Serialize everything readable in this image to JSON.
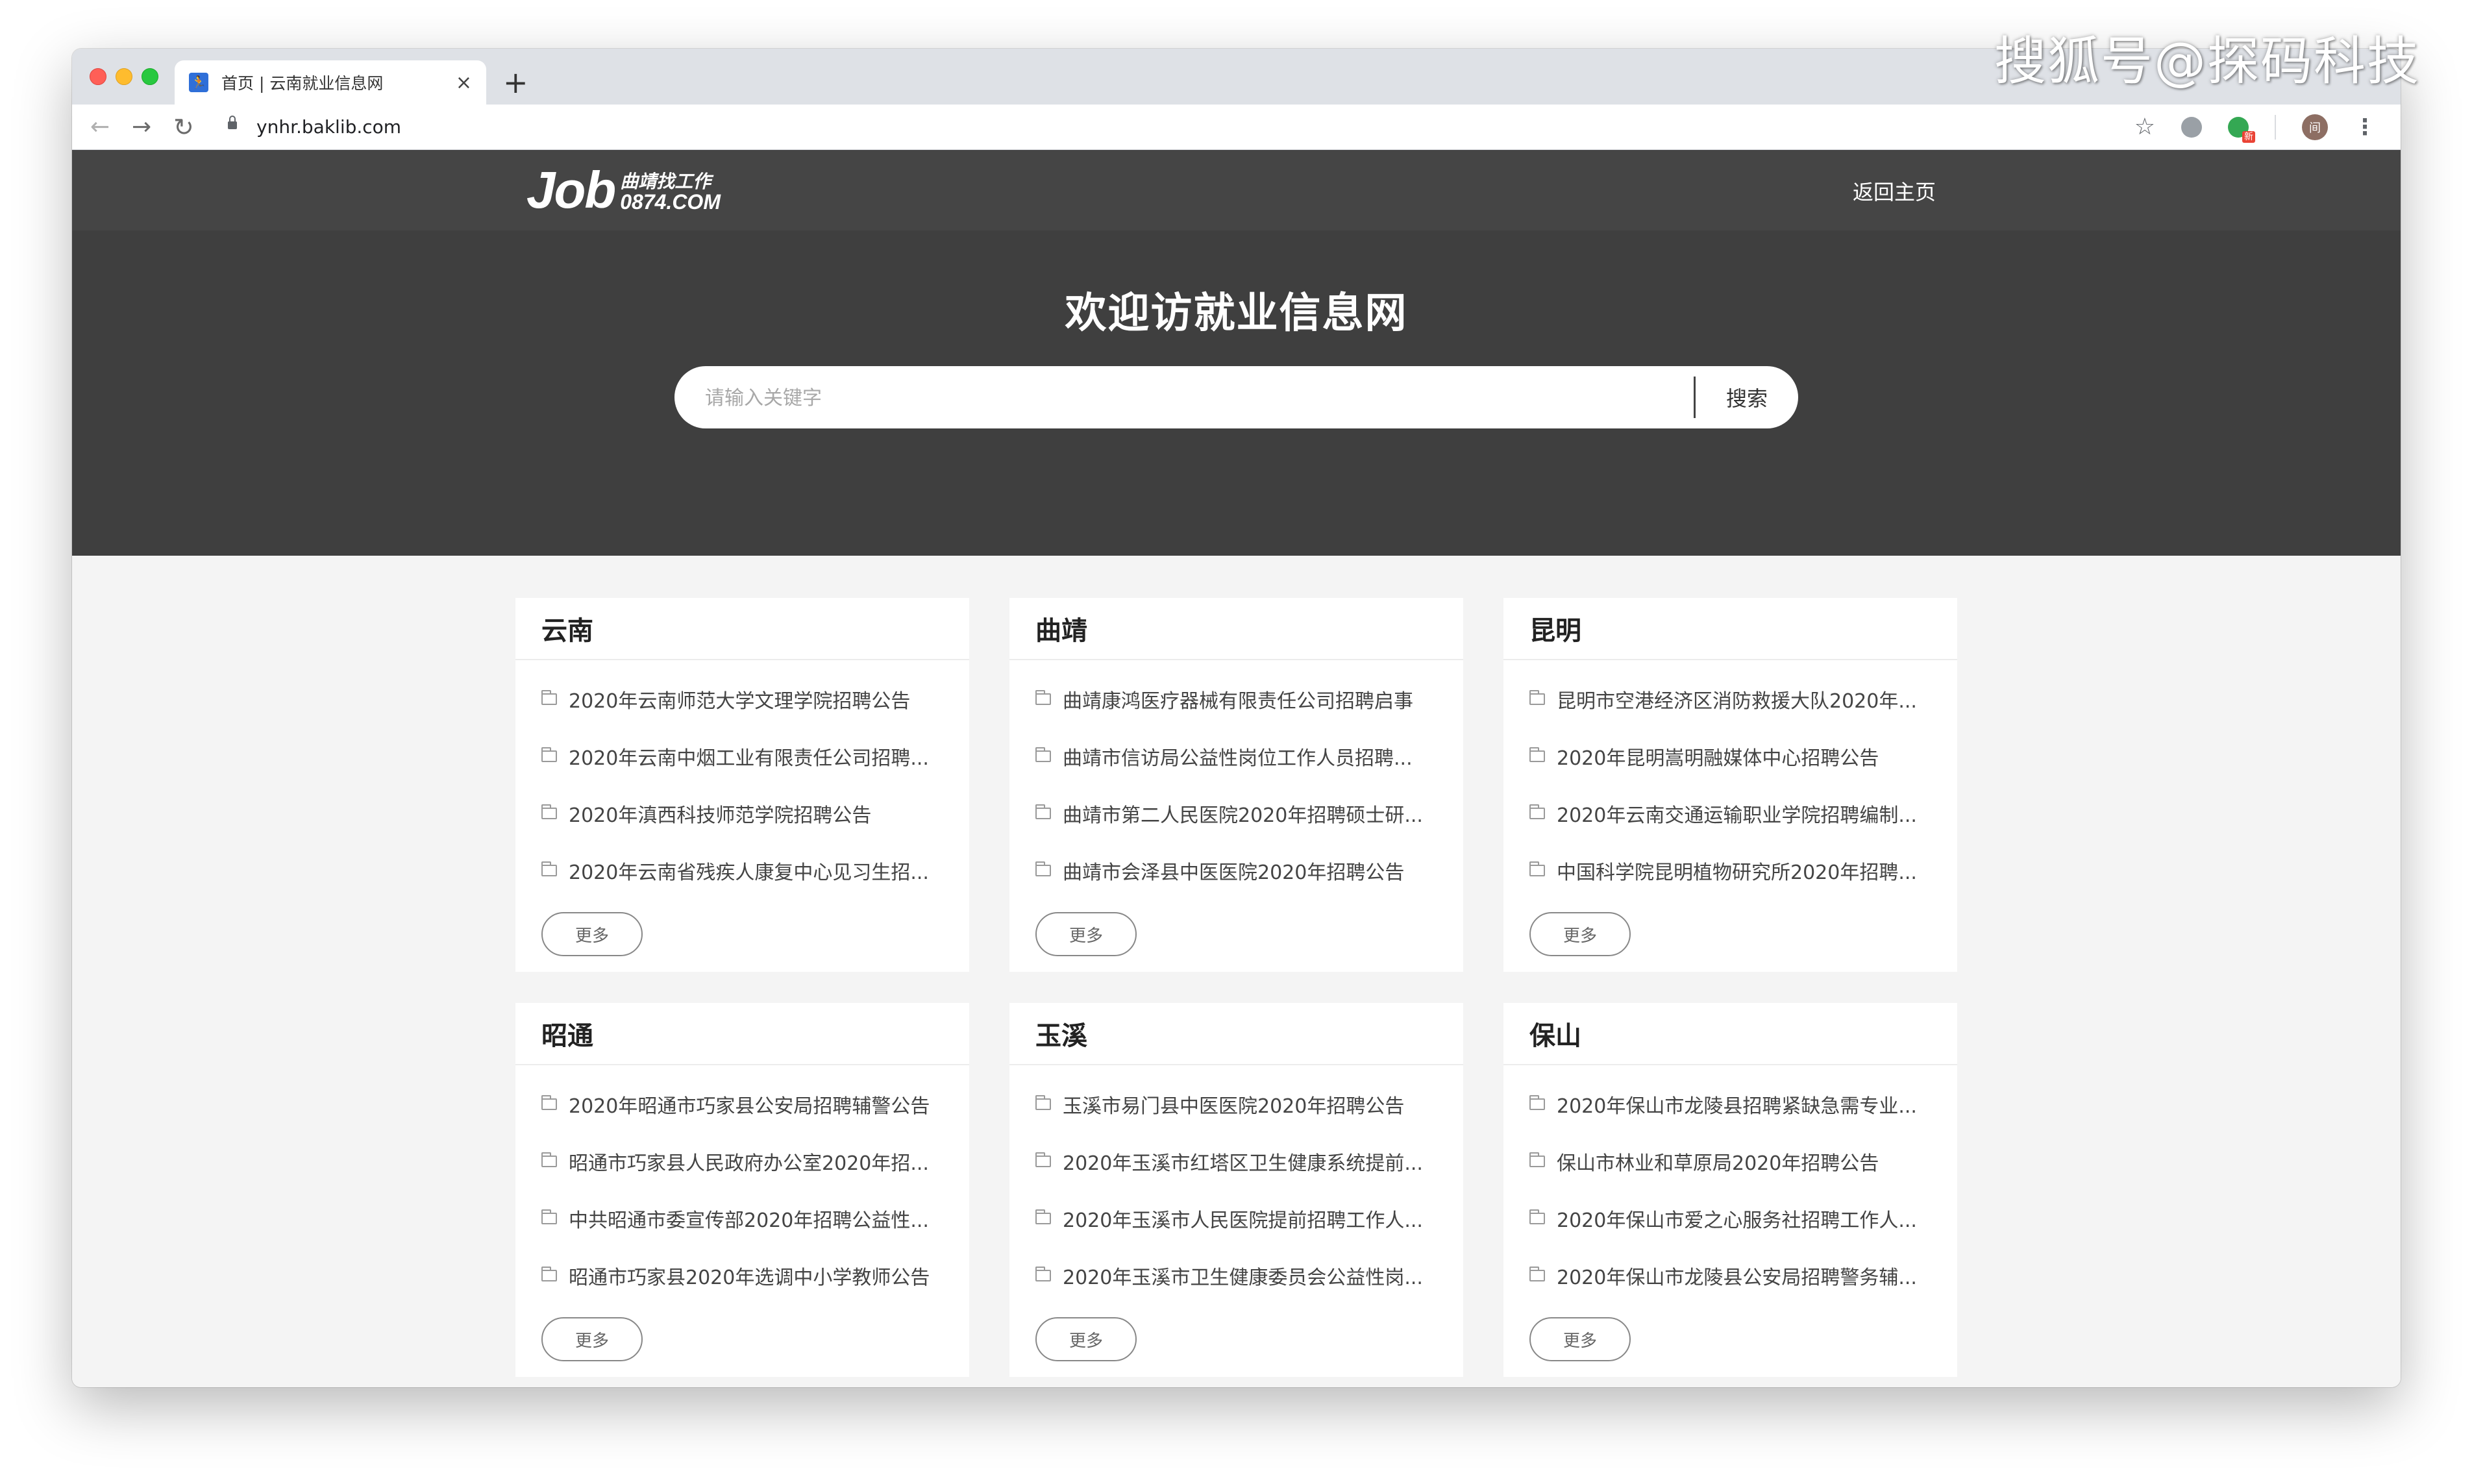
{
  "watermark": "搜狐号@探码科技",
  "browser": {
    "tab_title": "首页 | 云南就业信息网",
    "tab_favicon": "🏃",
    "tab_close": "×",
    "new_tab": "+",
    "url": "ynhr.baklib.com",
    "ext_badge": "新",
    "avatar_label": "间",
    "icons": {
      "back": "back-arrow-icon",
      "forward": "forward-arrow-icon",
      "reload": "reload-icon",
      "lock": "lock-icon",
      "bookmark": "star-icon",
      "menu": "kebab-icon"
    }
  },
  "header": {
    "logo_main": "Job",
    "logo_cn": "曲靖找工作",
    "logo_en": "0874.COM",
    "home_link": "返回主页"
  },
  "hero": {
    "title": "欢迎访就业信息网",
    "search_placeholder": "请输入关键字",
    "search_button": "搜索"
  },
  "colors": {
    "hero_bg": "#3f3f3f",
    "topbar_bg": "#454545",
    "page_bg": "#f4f4f4",
    "card_bg": "#ffffff"
  },
  "sections": [
    {
      "title": "云南",
      "items": [
        "2020年云南师范大学文理学院招聘公告",
        "2020年云南中烟工业有限责任公司招聘...",
        "2020年滇西科技师范学院招聘公告",
        "2020年云南省残疾人康复中心见习生招..."
      ],
      "more": "更多"
    },
    {
      "title": "曲靖",
      "items": [
        "曲靖康鸿医疗器械有限责任公司招聘启事",
        "曲靖市信访局公益性岗位工作人员招聘...",
        "曲靖市第二人民医院2020年招聘硕士研...",
        "曲靖市会泽县中医医院2020年招聘公告"
      ],
      "more": "更多"
    },
    {
      "title": "昆明",
      "items": [
        "昆明市空港经济区消防救援大队2020年...",
        "2020年昆明嵩明融媒体中心招聘公告",
        "2020年云南交通运输职业学院招聘编制...",
        "中国科学院昆明植物研究所2020年招聘..."
      ],
      "more": "更多"
    },
    {
      "title": "昭通",
      "items": [
        "2020年昭通市巧家县公安局招聘辅警公告",
        "昭通市巧家县人民政府办公室2020年招...",
        "中共昭通市委宣传部2020年招聘公益性...",
        "昭通市巧家县2020年选调中小学教师公告"
      ],
      "more": "更多"
    },
    {
      "title": "玉溪",
      "items": [
        "玉溪市易门县中医医院2020年招聘公告",
        "2020年玉溪市红塔区卫生健康系统提前...",
        "2020年玉溪市人民医院提前招聘工作人...",
        "2020年玉溪市卫生健康委员会公益性岗..."
      ],
      "more": "更多"
    },
    {
      "title": "保山",
      "items": [
        "2020年保山市龙陵县招聘紧缺急需专业...",
        "保山市林业和草原局2020年招聘公告",
        "2020年保山市爱之心服务社招聘工作人...",
        "2020年保山市龙陵县公安局招聘警务辅..."
      ],
      "more": "更多"
    }
  ]
}
